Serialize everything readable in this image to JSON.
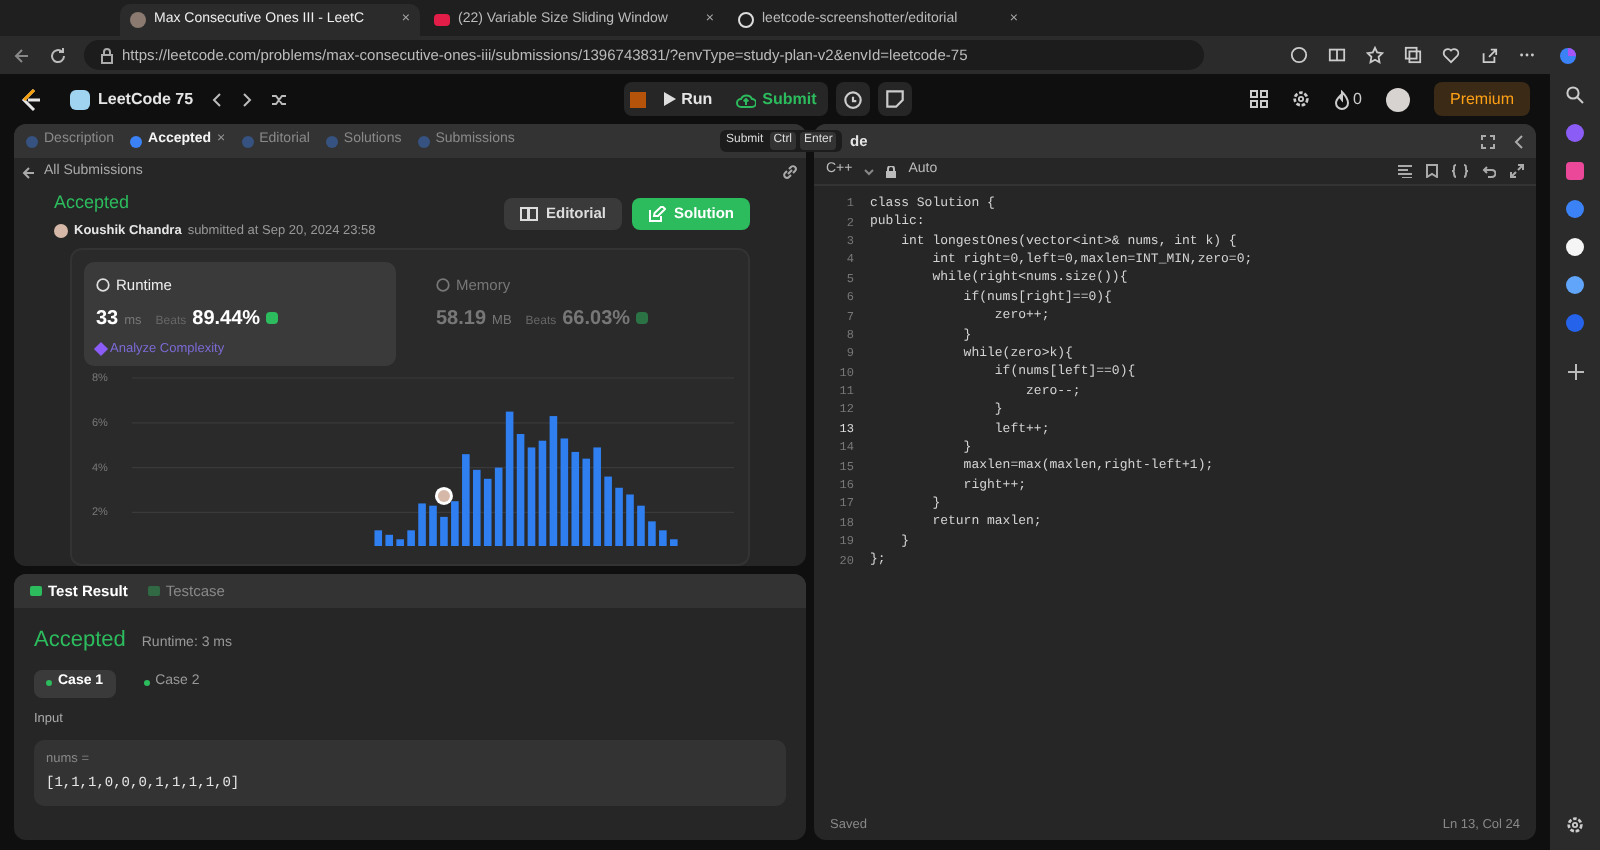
{
  "browser": {
    "tabs": [
      {
        "title": "Max Consecutive Ones III - LeetC",
        "selected": true,
        "kind": "photo",
        "close": "×"
      },
      {
        "title": "(22) Variable Size Sliding Window",
        "selected": false,
        "kind": "video",
        "close": "×"
      },
      {
        "title": "leetcode-screenshotter/editorial",
        "selected": false,
        "kind": "repo",
        "close": "×"
      }
    ],
    "url": "https://leetcode.com/problems/max-consecutive-ones-iii/submissions/1396743831/?envType=study-plan-v2&envId=leetcode-75"
  },
  "topbar": {
    "title": "LeetCode 75",
    "run": "Run",
    "submit": "Submit",
    "streak": "0",
    "premium": "Premium"
  },
  "tooltip": {
    "label": "Submit",
    "keys": [
      "Ctrl",
      "Enter"
    ]
  },
  "left_panel": {
    "tabs": [
      {
        "label": "Description",
        "selected": false
      },
      {
        "label": "Accepted",
        "selected": true,
        "close": "×"
      },
      {
        "label": "Editorial",
        "selected": false
      },
      {
        "label": "Solutions",
        "selected": false
      },
      {
        "label": "Submissions",
        "selected": false
      }
    ],
    "back_link": "All Submissions",
    "status": "Accepted",
    "author": "Koushik Chandra",
    "submitted": "submitted at Sep 20, 2024 23:58",
    "buttons": [
      {
        "label": "Editorial",
        "kind": "secondary"
      },
      {
        "label": "Solution",
        "kind": "primary"
      }
    ],
    "metrics": [
      {
        "label": "Runtime",
        "value": "33",
        "unit": "ms",
        "beats_label": "Beats",
        "percent": "89.44%",
        "link": "Analyze Complexity",
        "selected": true
      },
      {
        "label": "Memory",
        "value": "58.19",
        "unit": "MB",
        "beats_label": "Beats",
        "percent": "66.03%",
        "selected": false
      }
    ],
    "chart_data": {
      "type": "bar",
      "grid": true,
      "ylim": [
        0.5,
        8
      ],
      "yticks": [
        {
          "value": 2,
          "label": "2%"
        },
        {
          "value": 4,
          "label": "4%"
        },
        {
          "value": 6,
          "label": "6%"
        },
        {
          "value": 8,
          "label": "8%"
        }
      ],
      "series": [
        {
          "color": "#2f7ff0",
          "values": [
            null,
            null,
            null,
            null,
            null,
            null,
            null,
            null,
            null,
            null,
            null,
            null,
            null,
            null,
            null,
            null,
            null,
            null,
            null,
            null,
            null,
            null,
            1.2,
            1.0,
            0.8,
            1.2,
            2.4,
            2.3,
            1.8,
            2.5,
            4.6,
            3.9,
            3.5,
            4.0,
            6.5,
            5.5,
            4.9,
            5.2,
            6.3,
            5.3,
            4.7,
            4.4,
            4.9,
            3.6,
            3.1,
            2.8,
            2.3,
            1.6,
            1.2,
            0.8,
            null,
            null,
            null,
            null,
            null
          ]
        }
      ]
    }
  },
  "result_panel": {
    "tabs": [
      {
        "label": "Test Result",
        "selected": true
      },
      {
        "label": "Testcase",
        "selected": false
      }
    ],
    "status": "Accepted",
    "runtime": "Runtime: 3 ms",
    "cases": [
      {
        "label": "Case 1",
        "selected": true
      },
      {
        "label": "Case 2",
        "selected": false
      }
    ],
    "input_label": "Input",
    "var_name": "nums =",
    "var_value": "[1,1,1,0,0,0,1,1,1,1,0]"
  },
  "editor": {
    "title": "de",
    "language": "C++",
    "mode": "Auto",
    "lines": [
      {
        "number": "1",
        "text": "class Solution {",
        "current": false
      },
      {
        "number": "2",
        "text": "public:",
        "current": false
      },
      {
        "number": "3",
        "text": "    int longestOnes(vector<int>& nums, int k) {",
        "current": false
      },
      {
        "number": "4",
        "text": "        int right=0,left=0,maxlen=INT_MIN,zero=0;",
        "current": false
      },
      {
        "number": "5",
        "text": "        while(right<nums.size()){",
        "current": false
      },
      {
        "number": "6",
        "text": "            if(nums[right]==0){",
        "current": false
      },
      {
        "number": "7",
        "text": "                zero++;",
        "current": false
      },
      {
        "number": "8",
        "text": "            }",
        "current": false
      },
      {
        "number": "9",
        "text": "            while(zero>k){",
        "current": false
      },
      {
        "number": "10",
        "text": "                if(nums[left]==0){",
        "current": false
      },
      {
        "number": "11",
        "text": "                    zero--;",
        "current": false
      },
      {
        "number": "12",
        "text": "                }",
        "current": false
      },
      {
        "number": "13",
        "text": "                left++;",
        "current": true
      },
      {
        "number": "14",
        "text": "            }",
        "current": false
      },
      {
        "number": "15",
        "text": "            maxlen=max(maxlen,right-left+1);",
        "current": false
      },
      {
        "number": "16",
        "text": "            right++;",
        "current": false
      },
      {
        "number": "17",
        "text": "        }",
        "current": false
      },
      {
        "number": "18",
        "text": "        return maxlen;",
        "current": false
      },
      {
        "number": "19",
        "text": "    }",
        "current": false
      },
      {
        "number": "20",
        "text": "};",
        "current": false
      }
    ],
    "status": "Saved",
    "cursor": "Ln 13, Col 24"
  }
}
